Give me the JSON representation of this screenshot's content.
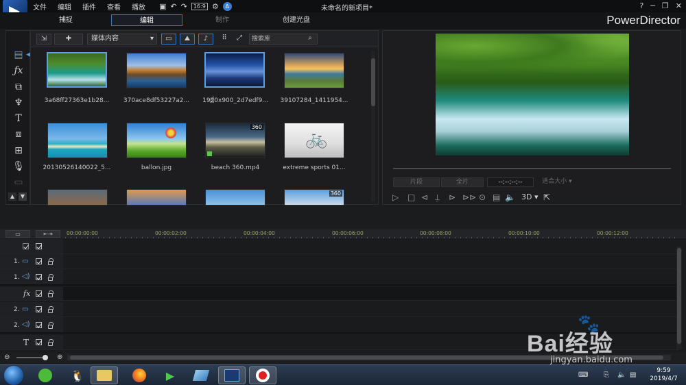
{
  "titlebar": {
    "menu": [
      "文件",
      "编辑",
      "插件",
      "查看",
      "播放"
    ],
    "project_title": "未命名的新项目*",
    "help": "?",
    "minimize": "─",
    "restore": "❐",
    "close": "✕"
  },
  "modes": {
    "capture": "捕捉",
    "edit": "编辑",
    "produce": "制作",
    "disc": "创建光盘",
    "brand": "PowerDirector"
  },
  "library": {
    "content_dropdown": "媒体内容",
    "search_placeholder": "搜索库",
    "items": [
      {
        "name": "3a68ff27363e1b28...",
        "badge": ""
      },
      {
        "name": "370ace8df53227a2...",
        "badge": ""
      },
      {
        "name": "1920x900_2d7edf9...",
        "badge": ""
      },
      {
        "name": "39107284_1411954...",
        "badge": ""
      },
      {
        "name": "20130526140022_5...",
        "badge": ""
      },
      {
        "name": "ballon.jpg",
        "badge": ""
      },
      {
        "name": "beach 360.mp4",
        "badge": "360"
      },
      {
        "name": "extreme sports 01...",
        "badge": ""
      },
      {
        "name": "",
        "badge": ""
      },
      {
        "name": "",
        "badge": ""
      },
      {
        "name": "",
        "badge": ""
      },
      {
        "name": "",
        "badge": "360"
      }
    ]
  },
  "preview": {
    "clip_btn": "片段",
    "movie_btn": "全片",
    "timecode": "--;--;--;--",
    "fit_dropdown": "适合大小",
    "mode_3d": "3D"
  },
  "timeline": {
    "ticks": [
      "00:00:00:00",
      "00:00:02:00",
      "00:00:04:00",
      "00:00:06:00",
      "00:00:08:00",
      "00:00:10:00",
      "00:00:12:00"
    ],
    "tracks": [
      {
        "label": "",
        "type": "master"
      },
      {
        "label": "1.",
        "type": "video"
      },
      {
        "label": "1.",
        "type": "audio"
      },
      {
        "label": "fx",
        "type": "fx"
      },
      {
        "label": "2.",
        "type": "video"
      },
      {
        "label": "2.",
        "type": "audio"
      },
      {
        "label": "T",
        "type": "title"
      }
    ]
  },
  "taskbar": {
    "time": "9:59",
    "date": "2019/4/7"
  },
  "watermark": {
    "text": "Bai经验",
    "url": "jingyan.baidu.com"
  }
}
